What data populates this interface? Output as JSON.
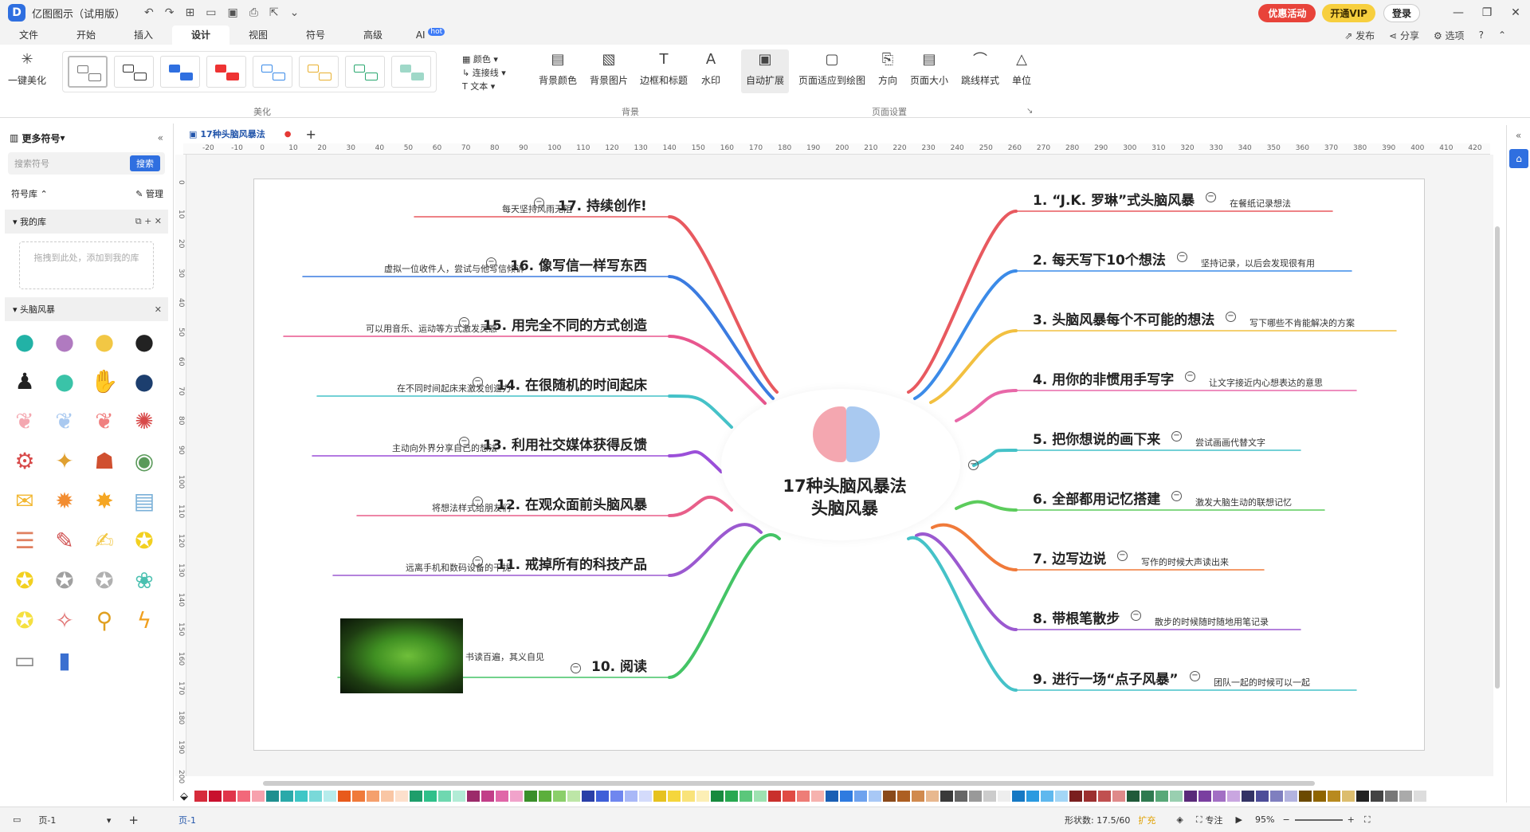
{
  "app": {
    "title": "亿图图示（试用版）",
    "logo": "D",
    "promo": "优惠活动",
    "vip": "开通VIP",
    "login": "登录"
  },
  "menu": {
    "items": [
      "文件",
      "开始",
      "插入",
      "设计",
      "视图",
      "符号",
      "高级",
      "AI"
    ],
    "hot": "hot",
    "right": [
      "发布",
      "分享",
      "选项"
    ]
  },
  "ribbon": {
    "beautify_label": "一键美化",
    "group_beautify": "美化",
    "color": "颜色",
    "connector": "连接线",
    "text": "文本",
    "bg_color": "背景颜色",
    "bg_image": "背景图片",
    "border_title": "边框和标题",
    "watermark": "水印",
    "group_bg": "背景",
    "auto_expand": "自动扩展",
    "fit_page": "页面适应到绘图",
    "direction": "方向",
    "page_size": "页面大小",
    "jump_style": "跳线样式",
    "unit": "单位",
    "group_page": "页面设置"
  },
  "sidebar": {
    "more_symbols": "更多符号",
    "search_placeholder": "搜索符号",
    "search_btn": "搜索",
    "library": "符号库",
    "manage": "管理",
    "my_lib": "我的库",
    "drop_hint": "拖拽到此处，添加到我的库",
    "brainstorm": "头脑风暴",
    "symbols": [
      "head-bulb-icon",
      "head-brain-icon",
      "head-gear-icon",
      "head-dark-icon",
      "person-bulb-icon",
      "head-bulb2-icon",
      "head-puzzle-icon",
      "head-brain2-icon",
      "brain-pink-icon",
      "brain-blue-icon",
      "brain-red-icon",
      "brain-gear-icon",
      "gears-icon",
      "tools-icon",
      "team-icon",
      "eye-icon",
      "speech-bubble-icon",
      "explosion-icon",
      "burst-icon",
      "note-board-icon",
      "checklist-icon",
      "notepad-icon",
      "pen-note-icon",
      "bulb-icon",
      "bulb-small-icon",
      "bulb-gear-icon",
      "bulb-gray-icon",
      "bulb-plant-icon",
      "bulb-yellow-icon",
      "magic-icon",
      "magnifier-icon",
      "lightning-icon",
      "slider-icon",
      "phone-icon"
    ]
  },
  "tab": {
    "name": "17种头脑风暴法"
  },
  "ruler": {
    "h": [
      "-20",
      "-10",
      "0",
      "10",
      "20",
      "30",
      "40",
      "50",
      "60",
      "70",
      "80",
      "90",
      "100",
      "110",
      "120",
      "130",
      "140",
      "150",
      "160",
      "170",
      "180",
      "190",
      "200",
      "210",
      "220",
      "230",
      "240",
      "250",
      "260",
      "270",
      "280",
      "290",
      "300",
      "310",
      "320",
      "330",
      "340",
      "350",
      "360",
      "370",
      "380",
      "390",
      "400",
      "410",
      "420"
    ],
    "v": [
      "0",
      "10",
      "20",
      "30",
      "40",
      "50",
      "60",
      "70",
      "80",
      "90",
      "100",
      "110",
      "120",
      "130",
      "140",
      "150",
      "160",
      "170",
      "180",
      "190",
      "200"
    ]
  },
  "mindmap": {
    "center_line1": "17种头脑风暴法",
    "center_line2": "头脑风暴",
    "left": [
      {
        "title": "17. 持续创作!",
        "note": "每天坚持风雨无阻",
        "color": "#e8595f"
      },
      {
        "title": "16. 像写信一样写东西",
        "note": "虚拟一位收件人，尝试与他写信倾诉",
        "color": "#3b7be0"
      },
      {
        "title": "15. 用完全不同的方式创造",
        "note": "可以用音乐、运动等方式激发灵感",
        "color": "#e8568e"
      },
      {
        "title": "14. 在很随机的时间起床",
        "note": "在不同时间起床来激发创造力",
        "color": "#45c2c8"
      },
      {
        "title": "13. 利用社交媒体获得反馈",
        "note": "主动向外界分享自己的想法",
        "color": "#9b4fd9"
      },
      {
        "title": "12. 在观众面前头脑风暴",
        "note": "将想法样式给朋友们",
        "color": "#e85f8a"
      },
      {
        "title": "11. 戒掉所有的科技产品",
        "note": "远离手机和数码设备的干扰",
        "color": "#9b59d0"
      },
      {
        "title": "10. 阅读",
        "note": "书读百遍，其义自见",
        "color": "#44c466"
      }
    ],
    "right": [
      {
        "title": "1. “J.K. 罗琳”式头脑风暴",
        "note": "在餐纸记录想法",
        "color": "#e8595f"
      },
      {
        "title": "2. 每天写下10个想法",
        "note": "坚持记录，以后会发现很有用",
        "color": "#3b8be8"
      },
      {
        "title": "3. 头脑风暴每个不可能的想法",
        "note": "写下哪些不肯能解决的方案",
        "color": "#f2c040"
      },
      {
        "title": "4. 用你的非惯用手写字",
        "note": "让文字接近内心想表达的意思",
        "color": "#e868a8"
      },
      {
        "title": "5. 把你想说的画下来",
        "note": "尝试画画代替文字",
        "color": "#45c2c8"
      },
      {
        "title": "6. 全部都用记忆搭建",
        "note": "激发大脑生动的联想记忆",
        "color": "#5ccc5c"
      },
      {
        "title": "7. 边写边说",
        "note": "写作的时候大声读出来",
        "color": "#f07a3a"
      },
      {
        "title": "8. 带根笔散步",
        "note": "散步的时候随时随地用笔记录",
        "color": "#9b59d0"
      },
      {
        "title": "9. 进行一场“点子风暴”",
        "note": "团队一起的时候可以一起",
        "color": "#45c2c8"
      }
    ]
  },
  "palette": [
    "#d62b3b",
    "#c8102e",
    "#e0344a",
    "#f2687a",
    "#f7a1ad",
    "#1f8f8f",
    "#2aa9a9",
    "#3ec6c6",
    "#79d9d9",
    "#b6ecec",
    "#e85a1b",
    "#f07a3a",
    "#f5a06d",
    "#f9c6a4",
    "#fde0cc",
    "#1e9e6b",
    "#2fc08a",
    "#6fd8b0",
    "#b2ecd6",
    "#9c2b6a",
    "#c23e88",
    "#e067a8",
    "#f1a3cb",
    "#3a8f2a",
    "#5caf3c",
    "#8bcf6a",
    "#bde6a7",
    "#2a3fa8",
    "#3f5fd8",
    "#6f86ef",
    "#a9b8f7",
    "#d4dbfb",
    "#e6c21f",
    "#f5d63c",
    "#f9e37a",
    "#fcefb5",
    "#178a3e",
    "#28a850",
    "#5bc77b",
    "#9ee2b1",
    "#c9302c",
    "#e04b44",
    "#ee7d77",
    "#f6b2ae",
    "#1a5fb4",
    "#2f7be0",
    "#6ea2ee",
    "#a8c8f6",
    "#8a4a1a",
    "#ad5f22",
    "#d18a4e",
    "#e8b88f",
    "#3a3a3a",
    "#666666",
    "#999999",
    "#cccccc",
    "#eeeeee",
    "#1679c4",
    "#2a9ae0",
    "#5fb8ee",
    "#a3d6f6",
    "#7a1f1f",
    "#9c2f2f",
    "#c05050",
    "#df8a8a",
    "#205a3a",
    "#2f7a50",
    "#58a878",
    "#99cfb0",
    "#5a2a7a",
    "#7a3fa0",
    "#a26fc4",
    "#c9a6e0",
    "#333366",
    "#4d4d99",
    "#7f7fbf",
    "#b3b3df",
    "#6b4a00",
    "#8f6500",
    "#b88a1f",
    "#dcbd6e",
    "#222222",
    "#444444",
    "#777777",
    "#aaaaaa",
    "#dddddd",
    "#ffffff"
  ],
  "status": {
    "page": "页-1",
    "page_tab": "页-1",
    "shapes": "形状数: 17.5/60",
    "expand": "扩充",
    "focus": "专注",
    "zoom": "95%"
  }
}
